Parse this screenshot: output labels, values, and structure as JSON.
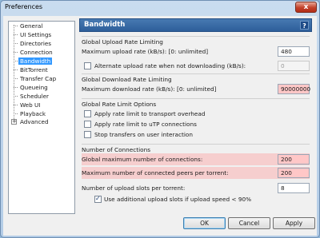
{
  "window": {
    "title": "Preferences",
    "close_glyph": "x"
  },
  "sidebar": {
    "items": [
      {
        "label": "General"
      },
      {
        "label": "UI Settings"
      },
      {
        "label": "Directories"
      },
      {
        "label": "Connection"
      },
      {
        "label": "Bandwidth",
        "selected": true
      },
      {
        "label": "BitTorrent"
      },
      {
        "label": "Transfer Cap"
      },
      {
        "label": "Queueing"
      },
      {
        "label": "Scheduler"
      },
      {
        "label": "Web UI"
      },
      {
        "label": "Playback"
      },
      {
        "label": "Advanced",
        "expander": "+"
      }
    ]
  },
  "panel": {
    "title": "Bandwidth",
    "help_glyph": "?",
    "upload": {
      "group_title": "Global Upload Rate Limiting",
      "max_label": "Maximum upload rate (kB/s): [0: unlimited]",
      "max_value": "480",
      "alt_label": "Alternate upload rate when not downloading (kB/s):",
      "alt_value": "0",
      "alt_checked": false
    },
    "download": {
      "group_title": "Global Download Rate Limiting",
      "max_label": "Maximum download rate (kB/s): [0: unlimited]",
      "max_value": "90000000"
    },
    "options": {
      "group_title": "Global Rate Limit Options",
      "transport_label": "Apply rate limit to transport overhead",
      "utp_label": "Apply rate limit to uTP connections",
      "stop_label": "Stop transfers on user interaction"
    },
    "connections": {
      "group_title": "Number of Connections",
      "global_label": "Global maximum number of connections:",
      "global_value": "200",
      "peers_label": "Maximum number of connected peers per torrent:",
      "peers_value": "200",
      "slots_label": "Number of upload slots per torrent:",
      "slots_value": "8",
      "additional_label": "Use additional upload slots if upload speed < 90%",
      "additional_checked": true
    }
  },
  "buttons": {
    "ok": "OK",
    "cancel": "Cancel",
    "apply": "Apply"
  },
  "colors": {
    "highlight": "#ffc7c7",
    "header": "#2d5e9a",
    "selection": "#3399ff"
  }
}
